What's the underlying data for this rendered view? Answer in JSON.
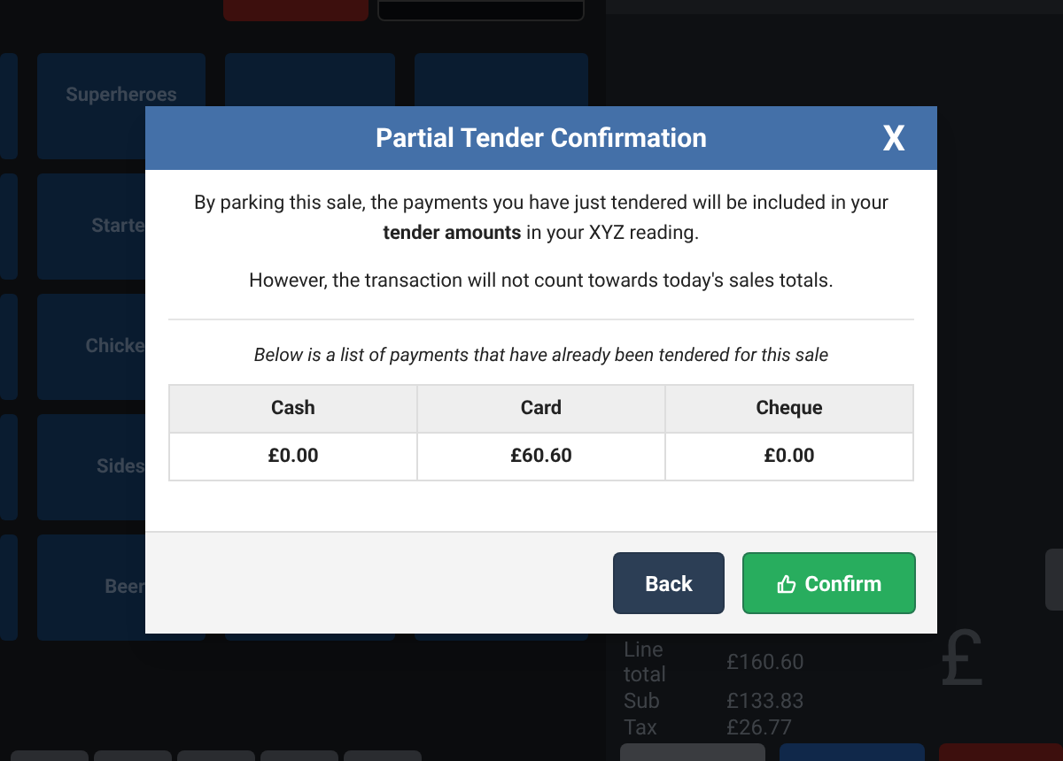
{
  "menu_tiles": [
    {
      "label": "Superheroes",
      "cut": false
    },
    {
      "label": "Starte",
      "cut": true
    },
    {
      "label": "Chicke",
      "cut": true
    },
    {
      "label": "Sides",
      "cut": true
    },
    {
      "label": "Beer",
      "cut": true
    }
  ],
  "totals": [
    {
      "label": "Line total",
      "value": "£160.60"
    },
    {
      "label": "Sub",
      "value": "£133.83"
    },
    {
      "label": "Tax",
      "value": "£26.77"
    }
  ],
  "big_total": "£",
  "dialog": {
    "title": "Partial Tender Confirmation",
    "close": "X",
    "message": "By parking this sale, the payments you have just tendered will be included in your **tender amounts** in your XYZ reading.",
    "note": "However, the transaction will not count towards today's sales totals.",
    "list_caption": "Below is a list of payments that have already been tendered for this sale",
    "payments": {
      "columns": [
        "Cash",
        "Card",
        "Cheque"
      ],
      "values": [
        "£0.00",
        "£60.60",
        "£0.00"
      ]
    },
    "buttons": [
      {
        "label": "Back",
        "kind": "secondary"
      },
      {
        "label": "Confirm",
        "kind": "primary"
      }
    ]
  }
}
